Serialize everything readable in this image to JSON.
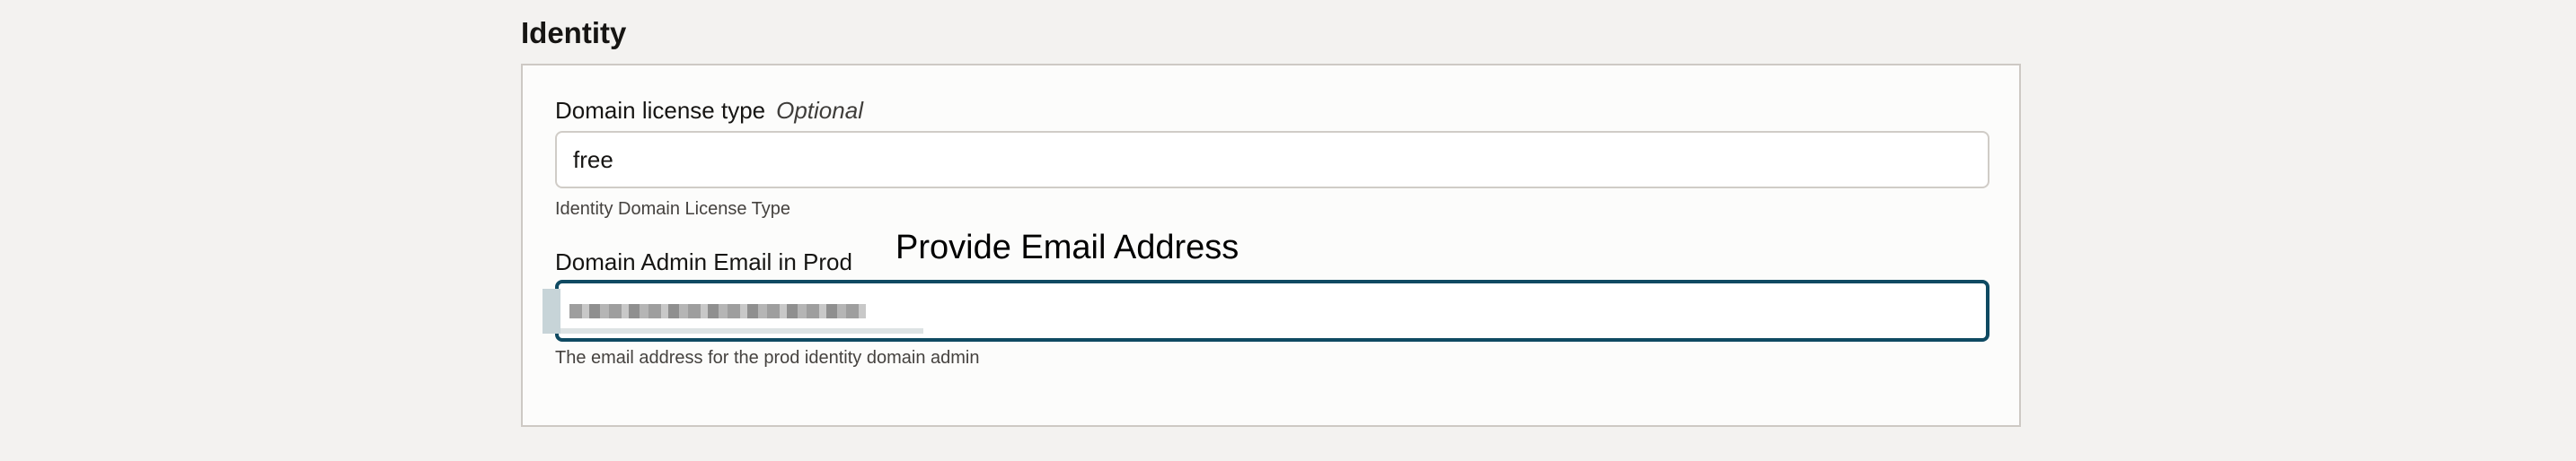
{
  "section": {
    "title": "Identity"
  },
  "fields": [
    {
      "label": "Domain license type",
      "optional": "Optional",
      "value": "free",
      "help": "Identity Domain License Type"
    },
    {
      "label": "Domain Admin Email in Prod",
      "value": "",
      "help": "The email address for the prod identity domain admin"
    }
  ],
  "annotation": {
    "text": "Provide Email Address"
  },
  "colors": {
    "focus_border": "#0f4a62",
    "page_bg": "#f3f2f0"
  }
}
